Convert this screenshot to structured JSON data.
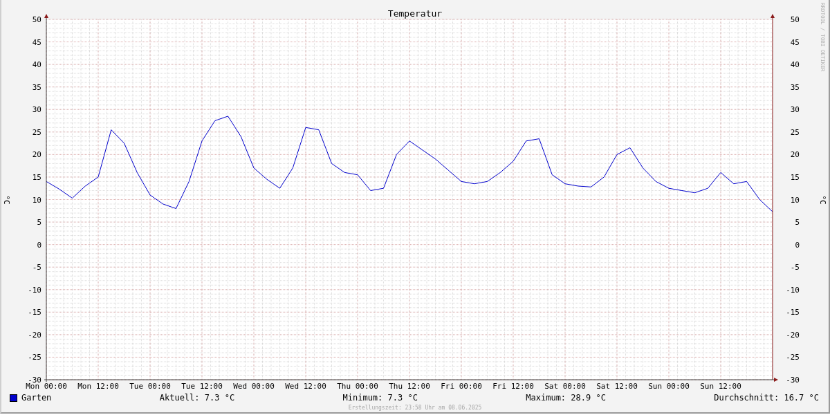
{
  "chart": {
    "credit": "RRDTOOL / TOBI OETIKER",
    "right_axis_label": "°C",
    "right_axis_ticks": [
      "50",
      "45",
      "40",
      "35",
      "30",
      "25",
      "20",
      "15",
      "10",
      "5",
      "0",
      "-5",
      "-10",
      "-15",
      "-20",
      "-25",
      "-30"
    ],
    "chart_data": {
      "type": "line",
      "title": "Temperatur",
      "ylabel": "°C",
      "categories": [
        "Mon 00:00",
        null,
        null,
        null,
        "Mon 12:00",
        null,
        null,
        null,
        "Tue 00:00",
        null,
        null,
        null,
        "Tue 12:00",
        null,
        null,
        null,
        "Wed 00:00",
        null,
        null,
        null,
        "Wed 12:00",
        null,
        null,
        null,
        "Thu 00:00",
        null,
        null,
        null,
        "Thu 12:00",
        null,
        null,
        null,
        "Fri 00:00",
        null,
        null,
        null,
        "Fri 12:00",
        null,
        null,
        null,
        "Sat 00:00",
        null,
        null,
        null,
        "Sat 12:00",
        null,
        null,
        null,
        "Sun 00:00",
        null,
        null,
        null,
        "Sun 12:00",
        null,
        null,
        null,
        null
      ],
      "series": [
        {
          "name": "Garten",
          "color": "#0000cc",
          "values": [
            14,
            12.3,
            10.3,
            13,
            15,
            25.5,
            22.5,
            16,
            11,
            9,
            8,
            14,
            23,
            27.5,
            28.5,
            24,
            17,
            14.5,
            12.5,
            17,
            26,
            25.5,
            18,
            16,
            15.5,
            12,
            12.5,
            20,
            23,
            21,
            19,
            16.5,
            14,
            13.5,
            14,
            16,
            18.5,
            23,
            23.5,
            15.5,
            13.5,
            13,
            12.8,
            15,
            20,
            21.5,
            17,
            14,
            12.5,
            12,
            11.5,
            12.5,
            16,
            13.5,
            14,
            10,
            7.3
          ]
        }
      ],
      "ylim": [
        -30,
        50
      ],
      "grid": true,
      "yticks": [
        -30,
        -25,
        -20,
        -15,
        -10,
        -5,
        0,
        5,
        10,
        15,
        20,
        25,
        30,
        35,
        40,
        45,
        50
      ]
    }
  },
  "legend": {
    "stats": [
      "Aktuell: 7.3 °C",
      "Minimum: 7.3 °C",
      "Maximum: 28.9 °C",
      "Durchschnitt: 16.7 °C"
    ]
  },
  "footer": "Erstellungszeit: 23:58 Uhr am 08.06.2025"
}
